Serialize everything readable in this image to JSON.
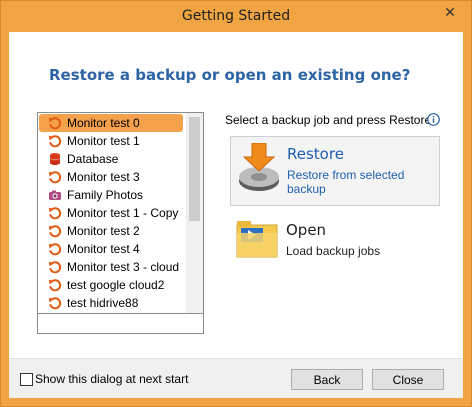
{
  "window": {
    "title": "Getting Started",
    "close_glyph": "✕"
  },
  "heading": "Restore a backup or open an existing one?",
  "backup_list": {
    "items": [
      {
        "label": "Monitor test 0",
        "icon": "restore-icon",
        "selected": true
      },
      {
        "label": "Monitor test 1",
        "icon": "restore-icon"
      },
      {
        "label": "Database",
        "icon": "database-icon"
      },
      {
        "label": "Monitor test 3",
        "icon": "restore-icon"
      },
      {
        "label": "Family Photos",
        "icon": "camera-icon"
      },
      {
        "label": "Monitor test 1 - Copy",
        "icon": "restore-icon"
      },
      {
        "label": "Monitor test 2",
        "icon": "restore-icon"
      },
      {
        "label": "Monitor test 4",
        "icon": "restore-icon"
      },
      {
        "label": "Monitor test 3 - cloud",
        "icon": "restore-icon"
      },
      {
        "label": "test google cloud2",
        "icon": "restore-icon"
      },
      {
        "label": "test hidrive88",
        "icon": "restore-icon"
      }
    ]
  },
  "instruction": "Select a backup job and press Restore",
  "restore_option": {
    "title": "Restore",
    "subtitle": "Restore from selected backup"
  },
  "open_option": {
    "title": "Open",
    "subtitle": "Load backup jobs"
  },
  "footer": {
    "show_dialog_label": "Show this dialog at next start",
    "show_dialog_checked": false,
    "back_label": "Back",
    "close_label": "Close"
  },
  "colors": {
    "title_bar": "#f0a542",
    "heading": "#2d64a6",
    "selected_item": "#f5a04a",
    "link_blue": "#1e5fb0",
    "restore_icon": "#e25a12"
  }
}
